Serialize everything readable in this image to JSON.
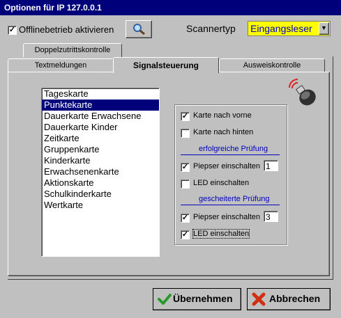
{
  "window": {
    "title": "Optionen für IP 127.0.0.1"
  },
  "top": {
    "offline_label": "Offlinebetrieb aktivieren",
    "offline_checked": true,
    "scanner_label": "Scannertyp",
    "scanner_value": "Eingangsleser"
  },
  "tabs": {
    "back": [
      "Doppelzutrittskontrolle"
    ],
    "front": [
      "Textmeldungen",
      "Signalsteuerung",
      "Ausweiskontrolle"
    ],
    "active": "Signalsteuerung"
  },
  "list": {
    "items": [
      "Tageskarte",
      "Punktekarte",
      "Dauerkarte Erwachsene",
      "Dauerkarte Kinder",
      "Zeitkarte",
      "Gruppenkarte",
      "Kinderkarte",
      "Erwachsenenkarte",
      "Aktionskarte",
      "Schulkinderkarte",
      "Wertkarte"
    ],
    "selected": "Punktekarte"
  },
  "signals": {
    "karte_vorne": "Karte nach vorne",
    "karte_hinten": "Karte nach hinten",
    "success_header": "erfolgreiche Prüfung",
    "success_piep": "Piepser einschalten",
    "success_piep_value": "1",
    "success_led": "LED einschalten",
    "fail_header": "gescheiterte Prüfung",
    "fail_piep": "Piepser einschalten",
    "fail_piep_value": "3",
    "fail_led": "LED einschalten"
  },
  "buttons": {
    "accept": "Übernehmen",
    "cancel": "Abbrechen"
  },
  "colors": {
    "title_bg": "#00007b",
    "selection": "#00007b",
    "scanner_text": "#0000c0",
    "accept_icon": "#2a9a2a",
    "cancel_icon": "#d03010"
  }
}
